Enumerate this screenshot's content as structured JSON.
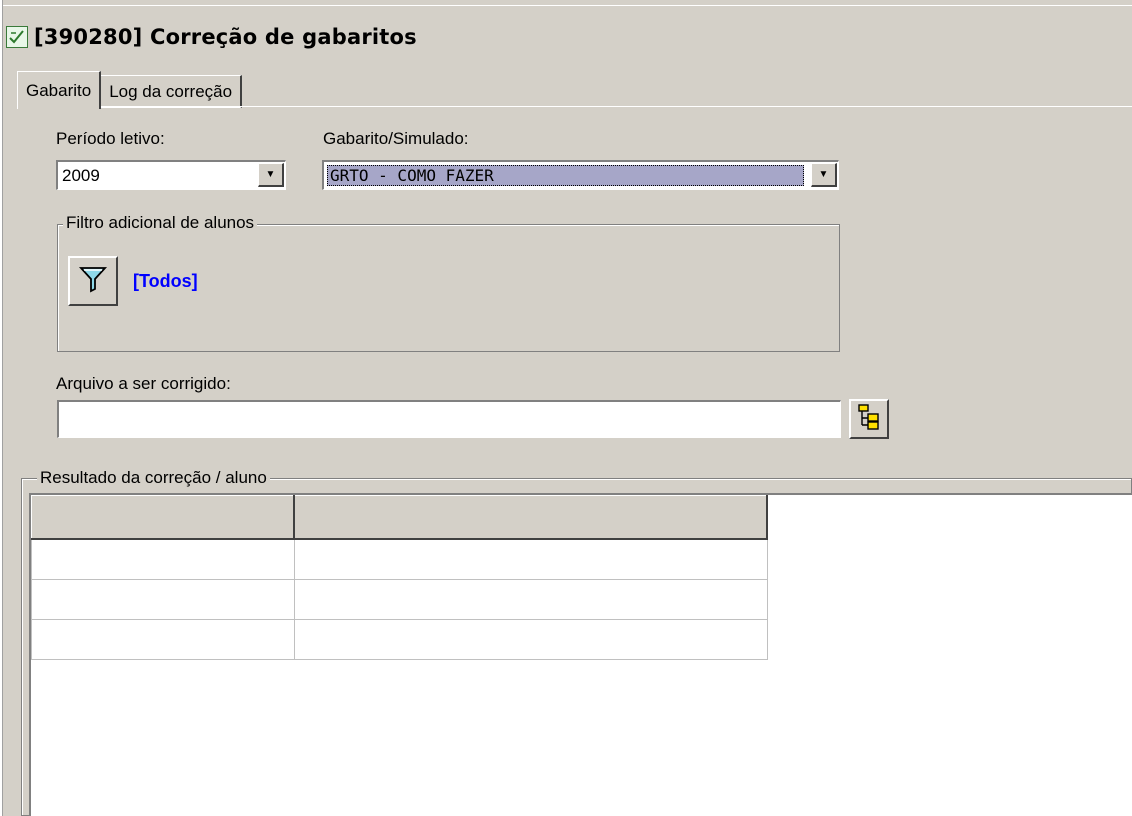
{
  "window": {
    "title": "[390280]  Correção de gabaritos",
    "icon": "checkmark-window-icon"
  },
  "tabs": [
    {
      "label": "Gabarito",
      "active": true
    },
    {
      "label": "Log da correção",
      "active": false
    }
  ],
  "form": {
    "periodo_label": "Período letivo:",
    "periodo_value": "2009",
    "gabarito_label": "Gabarito/Simulado:",
    "gabarito_value": "GRTO - COMO FAZER",
    "filtro_caption": "Filtro adicional de alunos",
    "filtro_value": "[Todos]",
    "filtro_icon": "funnel-icon",
    "arquivo_label": "Arquivo a ser corrigido:",
    "arquivo_value": "",
    "browse_icon": "folder-tree-icon"
  },
  "results": {
    "caption": "Resultado da correção / aluno",
    "columns": [
      "",
      ""
    ],
    "rows": [
      [
        "",
        ""
      ],
      [
        "",
        ""
      ],
      [
        "",
        ""
      ]
    ]
  },
  "colors": {
    "link": "#0000ff",
    "face": "#d4d0c8",
    "selection": "#a6a6c8"
  }
}
